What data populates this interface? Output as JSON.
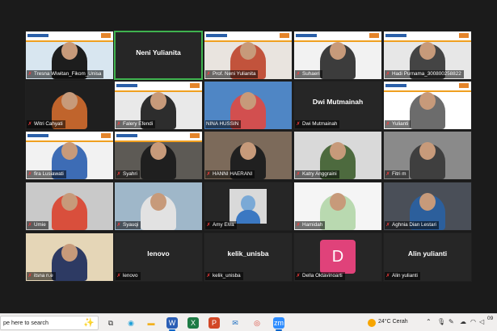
{
  "participants": [
    {
      "name": "Tresna Wiwitan_Fikom_Unisa",
      "type": "video",
      "muted": true,
      "bg": "#d8e6f0",
      "cloth": "#1d1d1d",
      "slide": true
    },
    {
      "name": "Neni Yulianita",
      "type": "name",
      "center_name": "Neni Yulianita",
      "active": true
    },
    {
      "name": "Prof. Neni Yulianita",
      "type": "video",
      "muted": true,
      "bg": "#e9e4df",
      "cloth": "#c2533c",
      "slide": true
    },
    {
      "name": "Suhaeri",
      "type": "video",
      "muted": true,
      "bg": "#f2f2f2",
      "cloth": "#3c3c3c",
      "slide": true
    },
    {
      "name": "Hadi Purnama_300800258822",
      "type": "video",
      "muted": true,
      "bg": "#e7e7e7",
      "cloth": "#444444",
      "slide": true
    },
    {
      "name": "Witri Cahyati",
      "type": "video",
      "muted": true,
      "bg": "#1f1f1f",
      "cloth": "#c0642c",
      "slide": false
    },
    {
      "name": "Falery Efendi",
      "type": "video",
      "muted": true,
      "bg": "#e9e9e9",
      "cloth": "#2d2d2d",
      "slide": true
    },
    {
      "name": "NINA HUSSIN",
      "type": "video",
      "muted": false,
      "bg": "#4f86c5",
      "cloth": "#d24f4f",
      "slide": false
    },
    {
      "name": "Dwi Mutmainah",
      "type": "name",
      "center_name": "Dwi Mutmainah",
      "muted": true
    },
    {
      "name": "Yulianti",
      "type": "video",
      "muted": true,
      "bg": "#ffffff",
      "cloth": "#6c6c6c",
      "slide": true
    },
    {
      "name": "fira Lusiawati",
      "type": "video",
      "muted": true,
      "bg": "#f2f2f2",
      "cloth": "#3d6cb5",
      "slide": true
    },
    {
      "name": "Syahri",
      "type": "video",
      "muted": true,
      "bg": "#5d5a55",
      "cloth": "#1f1f1f",
      "slide": true
    },
    {
      "name": "HANNI HAERANI",
      "type": "video",
      "muted": true,
      "bg": "#7c6a5a",
      "cloth": "#202020",
      "slide": false
    },
    {
      "name": "Katry Anggraini",
      "type": "video",
      "muted": true,
      "bg": "#d9d9d9",
      "cloth": "#4d6a3e",
      "slide": false
    },
    {
      "name": "Fitri m",
      "type": "video",
      "muted": true,
      "bg": "#8a8a8a",
      "cloth": "#3f3f3f",
      "slide": false
    },
    {
      "name": "Umie",
      "type": "video",
      "muted": true,
      "bg": "#c9c9c9",
      "cloth": "#d94f3c",
      "slide": false
    },
    {
      "name": "Syauqi",
      "type": "video",
      "muted": true,
      "bg": "#9fb7c9",
      "cloth": "#e2e2e2",
      "slide": false
    },
    {
      "name": "Amy Elva",
      "type": "avatar",
      "muted": true
    },
    {
      "name": "Hamidah",
      "type": "video",
      "muted": true,
      "bg": "#f5f5f5",
      "cloth": "#b9d9b0",
      "slide": false
    },
    {
      "name": "Aghnia Dian Lestari",
      "type": "video",
      "muted": true,
      "bg": "#4a4f58",
      "cloth": "#2c5f9c",
      "slide": false
    },
    {
      "name": "itsna n.e",
      "type": "video",
      "muted": true,
      "bg": "#e5d6b7",
      "cloth": "#2d3a63",
      "slide": false
    },
    {
      "name": "lenovo",
      "type": "name",
      "center_name": "lenovo",
      "muted": true
    },
    {
      "name": "kelik_unisba",
      "type": "name",
      "center_name": "kelik_unisba",
      "muted": true
    },
    {
      "name": "Della Oktavinoarti",
      "type": "letter",
      "letter": "D",
      "muted": true
    },
    {
      "name": "Alin yulianti",
      "type": "name",
      "center_name": "Alin yulianti",
      "muted": true
    }
  ],
  "taskbar": {
    "search_text": "pe here to search",
    "apps": [
      {
        "name": "task-view-icon",
        "glyph": "⧉",
        "color": "#333333",
        "bg": "transparent",
        "active": false
      },
      {
        "name": "edge-icon",
        "glyph": "◉",
        "color": "#1fa0d8",
        "bg": "transparent",
        "active": false
      },
      {
        "name": "file-explorer-icon",
        "glyph": "▬",
        "color": "#f2b01e",
        "bg": "transparent",
        "active": false
      },
      {
        "name": "word-icon",
        "glyph": "W",
        "color": "#ffffff",
        "bg": "#2b5eb5",
        "active": true
      },
      {
        "name": "excel-icon",
        "glyph": "X",
        "color": "#ffffff",
        "bg": "#1e7b45",
        "active": false
      },
      {
        "name": "powerpoint-icon",
        "glyph": "P",
        "color": "#ffffff",
        "bg": "#d24726",
        "active": false
      },
      {
        "name": "mail-icon",
        "glyph": "✉",
        "color": "#1b6ec2",
        "bg": "transparent",
        "active": false
      },
      {
        "name": "chrome-icon",
        "glyph": "◎",
        "color": "#db4437",
        "bg": "transparent",
        "active": false
      },
      {
        "name": "zoom-icon",
        "glyph": "zm",
        "color": "#ffffff",
        "bg": "#2d8cff",
        "active": true
      }
    ],
    "weather_text": "24°C  Cerah",
    "clock_time": "09"
  }
}
